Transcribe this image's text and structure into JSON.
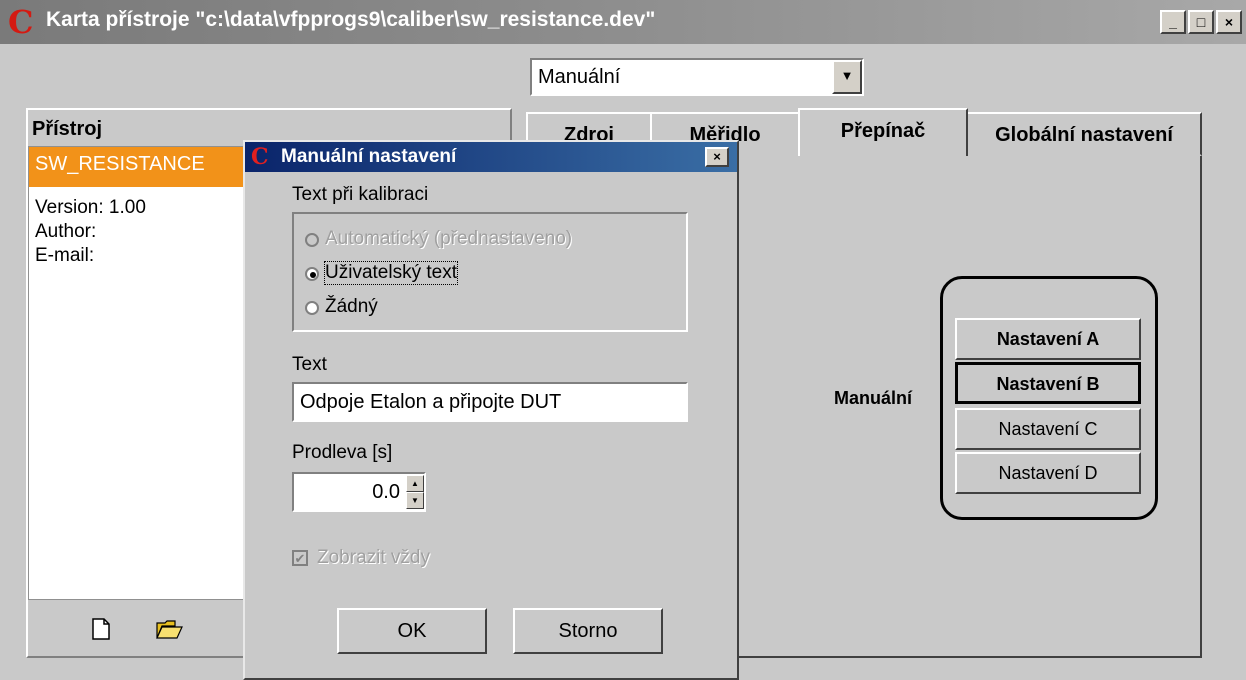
{
  "window": {
    "title": "Karta přístroje \"c:\\data\\vfpprogs9\\caliber\\sw_resistance.dev\"",
    "logo_letter": "C",
    "minimize": "_",
    "maximize": "□",
    "close": "×"
  },
  "mode_combo": {
    "value": "Manuální",
    "arrow": "▼"
  },
  "left_panel": {
    "title": "Přístroj",
    "selected_item": "SW_RESISTANCE",
    "info": [
      "Version: 1.00",
      "Author:",
      "E-mail:"
    ]
  },
  "tabs": [
    {
      "label": "Zdroj"
    },
    {
      "label": "Měřidlo"
    },
    {
      "label": "Přepínač"
    },
    {
      "label": "Globální nastavení"
    }
  ],
  "switch_panel": {
    "label": "Manuální",
    "buttons": [
      "Nastavení A",
      "Nastavení B",
      "Nastavení C",
      "Nastavení D"
    ]
  },
  "dialog": {
    "title": "Manuální nastavení",
    "logo_letter": "C",
    "close": "×",
    "group_label": "Text při kalibraci",
    "options": [
      {
        "label": "Automatický (přednastaveno)",
        "checked": false,
        "enabled": false
      },
      {
        "label": "Uživatelský text",
        "checked": true,
        "enabled": true
      },
      {
        "label": "Žádný",
        "checked": false,
        "enabled": true
      }
    ],
    "text_label": "Text",
    "text_value": "Odpoje Etalon a připojte DUT",
    "delay_label": "Prodleva [s]",
    "delay_value": "0.0",
    "always_show_label": "Zobrazit vždy",
    "ok": "OK",
    "cancel": "Storno"
  }
}
